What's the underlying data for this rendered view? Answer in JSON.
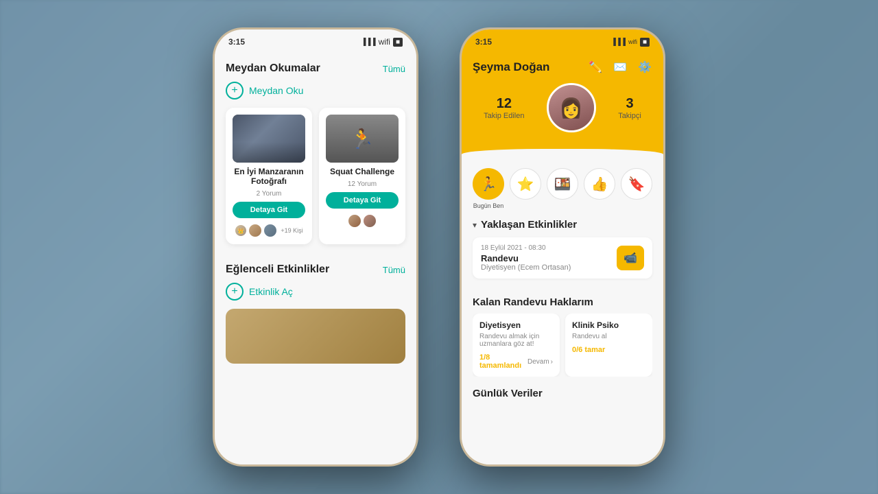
{
  "background": {
    "color": "#7a9db5"
  },
  "left_phone": {
    "time": "3:15",
    "sections": [
      {
        "id": "challenges",
        "title": "Meydan Okumalar",
        "link": "Tümü",
        "add_label": "Meydan Oku",
        "cards": [
          {
            "id": "card1",
            "title": "En İyi Manzaranın Fotoğrafı",
            "subtitle": "2 Yorum",
            "btn_label": "Detaya Git",
            "avatars_count": "+19 Kişi"
          },
          {
            "id": "card2",
            "title": "Squat Challenge",
            "subtitle": "12 Yorum",
            "btn_label": "Detaya Git",
            "avatars_count": ""
          }
        ]
      },
      {
        "id": "activities",
        "title": "Eğlenceli Etkinlikler",
        "link": "Tümü",
        "add_label": "Etkinlik Aç"
      }
    ]
  },
  "right_phone": {
    "time": "3:15",
    "profile": {
      "name": "Şeyma Doğan",
      "following_count": "12",
      "following_label": "Takip Edilen",
      "followers_count": "3",
      "followers_label": "Takipçi"
    },
    "badges": [
      {
        "id": "today",
        "label": "Bugün Ben",
        "active": true,
        "icon": "🏃"
      },
      {
        "id": "star",
        "label": "",
        "active": false,
        "icon": "⭐"
      },
      {
        "id": "food",
        "label": "",
        "active": false,
        "icon": "🍱"
      },
      {
        "id": "social",
        "label": "",
        "active": false,
        "icon": "👍"
      },
      {
        "id": "bookmark",
        "label": "",
        "active": false,
        "icon": "🔖"
      }
    ],
    "upcoming": {
      "section_title": "Yaklaşan Etkinlikler",
      "appointment": {
        "type": "Randevu",
        "date": "18 Eylül 2021 - 08:30",
        "doctor": "Diyetisyen  (Ecem Ortasan)"
      }
    },
    "remaining": {
      "section_title": "Kalan Randevu Haklarım",
      "cards": [
        {
          "title": "Diyetisyen",
          "desc": "Randevu almak için uzmanlara göz at!",
          "progress": "1/8 tamamlandı",
          "action": "Devam"
        },
        {
          "title": "Klinik Psiko",
          "desc": "Randevu al",
          "progress": "0/6 tamar",
          "action": ""
        }
      ]
    },
    "daily": {
      "section_title": "Günlük Veriler"
    }
  }
}
